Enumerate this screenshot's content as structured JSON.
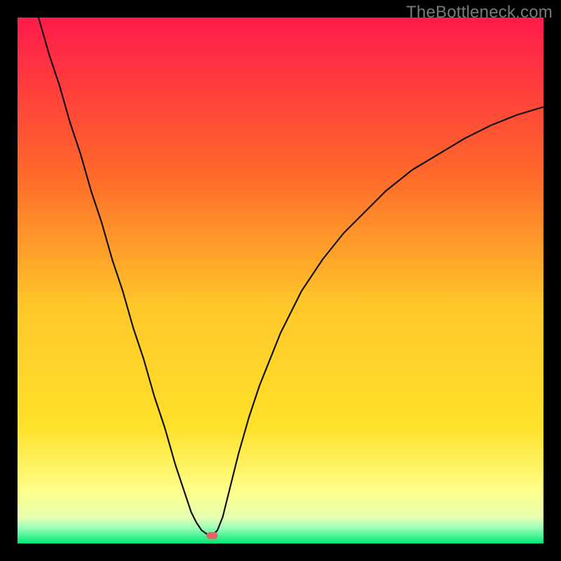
{
  "watermark": "TheBottleneck.com",
  "chart_data": {
    "type": "line",
    "title": "",
    "xlabel": "",
    "ylabel": "",
    "xlim": [
      0,
      100
    ],
    "ylim": [
      0,
      100
    ],
    "background_gradient": {
      "top": "#ff1a4b",
      "mid_upper": "#ff8a2a",
      "mid": "#ffe12a",
      "mid_lower": "#ffff8a",
      "bottom": "#00e676"
    },
    "annotations": [
      {
        "name": "min-marker",
        "x": 37,
        "y": 1.5,
        "color": "#e06666",
        "shape": "pill"
      }
    ],
    "series": [
      {
        "name": "bottleneck-curve",
        "color": "#111111",
        "x": [
          4,
          6,
          8,
          10,
          12,
          14,
          16,
          18,
          20,
          22,
          24,
          26,
          28,
          30,
          32,
          33,
          34,
          35,
          36,
          37,
          38,
          39,
          40,
          42,
          44,
          46,
          48,
          50,
          54,
          58,
          62,
          66,
          70,
          75,
          80,
          85,
          90,
          95,
          100
        ],
        "y": [
          100,
          93,
          87,
          80,
          74,
          67,
          61,
          54,
          48,
          41,
          35,
          28,
          22,
          15,
          9,
          6,
          4,
          2.5,
          1.8,
          1.5,
          2.5,
          5,
          9,
          17,
          24,
          30,
          35,
          40,
          48,
          54,
          59,
          63,
          67,
          71,
          74,
          77,
          79.5,
          81.5,
          83
        ]
      }
    ]
  }
}
